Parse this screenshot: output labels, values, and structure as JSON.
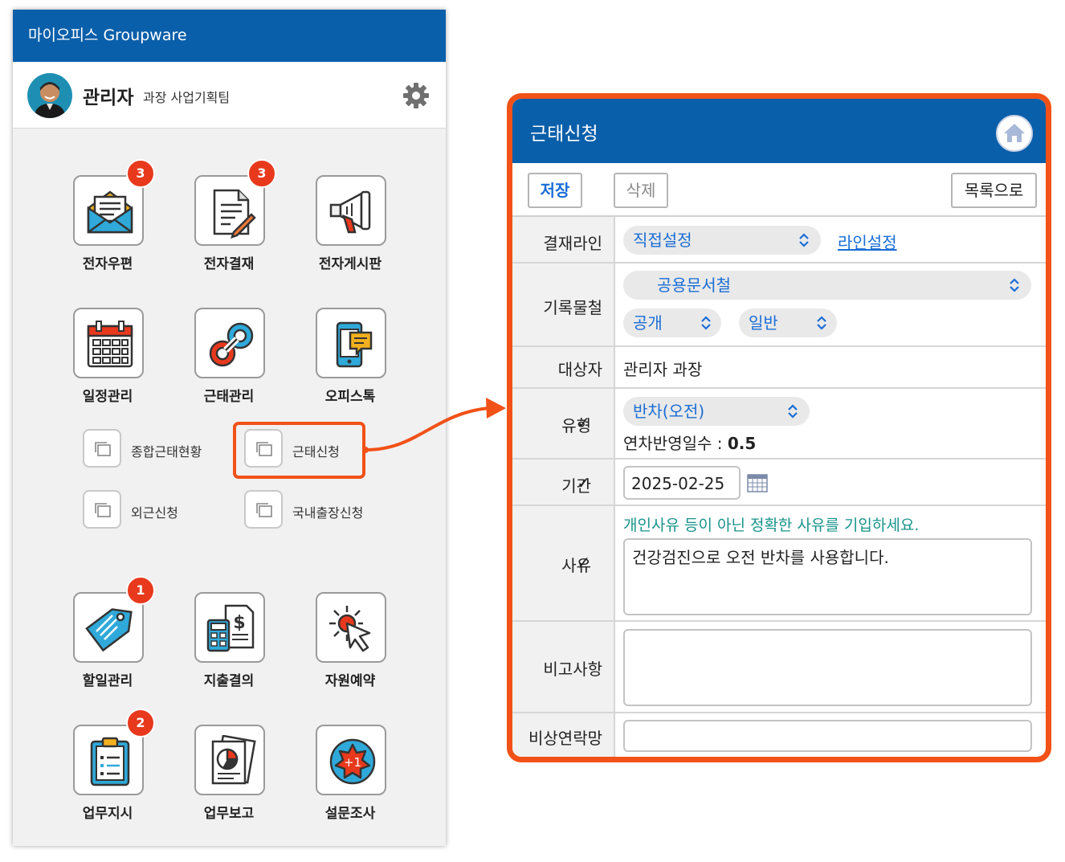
{
  "app": {
    "title": "마이오피스 Groupware"
  },
  "profile": {
    "name": "관리자",
    "info": "과장 사업기획팀"
  },
  "menu": {
    "tiles": [
      {
        "label": "전자우편",
        "badge": "3",
        "icon": "mail-icon"
      },
      {
        "label": "전자결재",
        "badge": "3",
        "icon": "document-sign-icon"
      },
      {
        "label": "전자게시판",
        "badge": null,
        "icon": "megaphone-icon"
      },
      {
        "label": "일정관리",
        "badge": null,
        "icon": "calendar-icon"
      },
      {
        "label": "근태관리",
        "badge": null,
        "icon": "link-icon"
      },
      {
        "label": "오피스톡",
        "badge": null,
        "icon": "phone-chat-icon"
      },
      {
        "label": "할일관리",
        "badge": "1",
        "icon": "tag-icon"
      },
      {
        "label": "지출결의",
        "badge": null,
        "icon": "calculator-money-icon"
      },
      {
        "label": "자원예약",
        "badge": null,
        "icon": "cursor-click-icon"
      },
      {
        "label": "업무지시",
        "badge": "2",
        "icon": "clipboard-icon"
      },
      {
        "label": "업무보고",
        "badge": null,
        "icon": "report-chart-icon"
      },
      {
        "label": "설문조사",
        "badge": null,
        "icon": "plus-one-badge-icon"
      }
    ],
    "submenu": [
      "종합근태현황",
      "근태신청",
      "외근신청",
      "국내출장신청"
    ]
  },
  "form": {
    "title": "근태신청",
    "buttons": {
      "save": "저장",
      "delete": "삭제",
      "list": "목록으로"
    },
    "approval_line": {
      "label": "결재라인",
      "select": "직접설정",
      "link": "라인설정"
    },
    "record_file": {
      "label": "기록물철",
      "select": "공용문서철",
      "visibility": "공개",
      "category": "일반"
    },
    "target": {
      "label": "대상자",
      "value": "관리자 과장"
    },
    "type": {
      "label": "유형",
      "select": "반차(오전)",
      "days_label": "연차반영일수 : ",
      "days_value": "0.5"
    },
    "period": {
      "label": "기간",
      "value": "2025-02-25"
    },
    "reason": {
      "label": "사유",
      "hint": "개인사유 등이 아닌 정확한 사유를 기입하세요.",
      "value": "건강검진으로 오전 반차를 사용합니다."
    },
    "remarks": {
      "label": "비고사항",
      "value": ""
    },
    "emergency": {
      "label": "비상연락망",
      "value": ""
    }
  },
  "colors": {
    "brand_blue": "#0a5faa",
    "highlight": "#f25117",
    "badge": "#e8391d",
    "link": "#1a6dd6",
    "hint": "#17938a"
  }
}
